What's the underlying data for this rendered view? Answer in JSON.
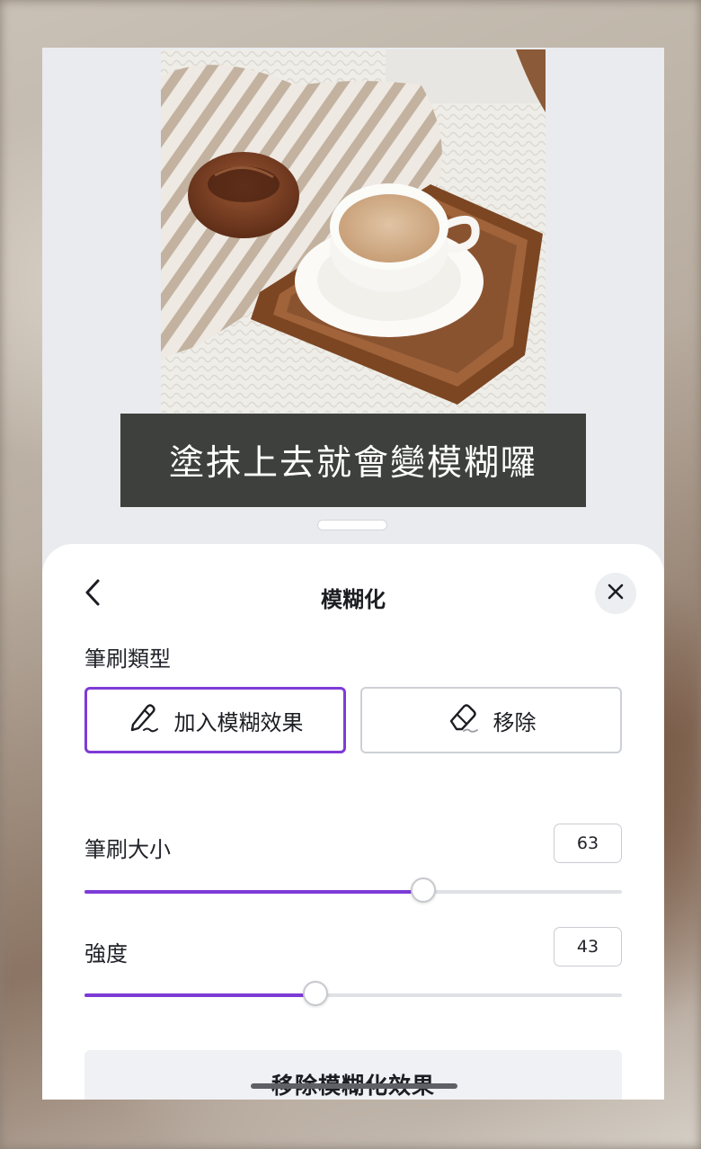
{
  "caption": {
    "text": "塗抹上去就會變模糊囉"
  },
  "panel": {
    "title": "模糊化",
    "back_icon": "chevron-left-icon",
    "close_icon": "close-icon"
  },
  "brush_type": {
    "label": "筆刷類型",
    "options": [
      {
        "label": "加入模糊效果",
        "icon": "brush-icon",
        "selected": true
      },
      {
        "label": "移除",
        "icon": "eraser-icon",
        "selected": false
      }
    ]
  },
  "brush_size": {
    "label": "筆刷大小",
    "value": "63",
    "fraction": 0.63
  },
  "intensity": {
    "label": "強度",
    "value": "43",
    "fraction": 0.43
  },
  "remove_button": {
    "label": "移除模糊化效果"
  },
  "colors": {
    "accent": "#7d3bd6",
    "caption_bg": "#3e403d"
  }
}
